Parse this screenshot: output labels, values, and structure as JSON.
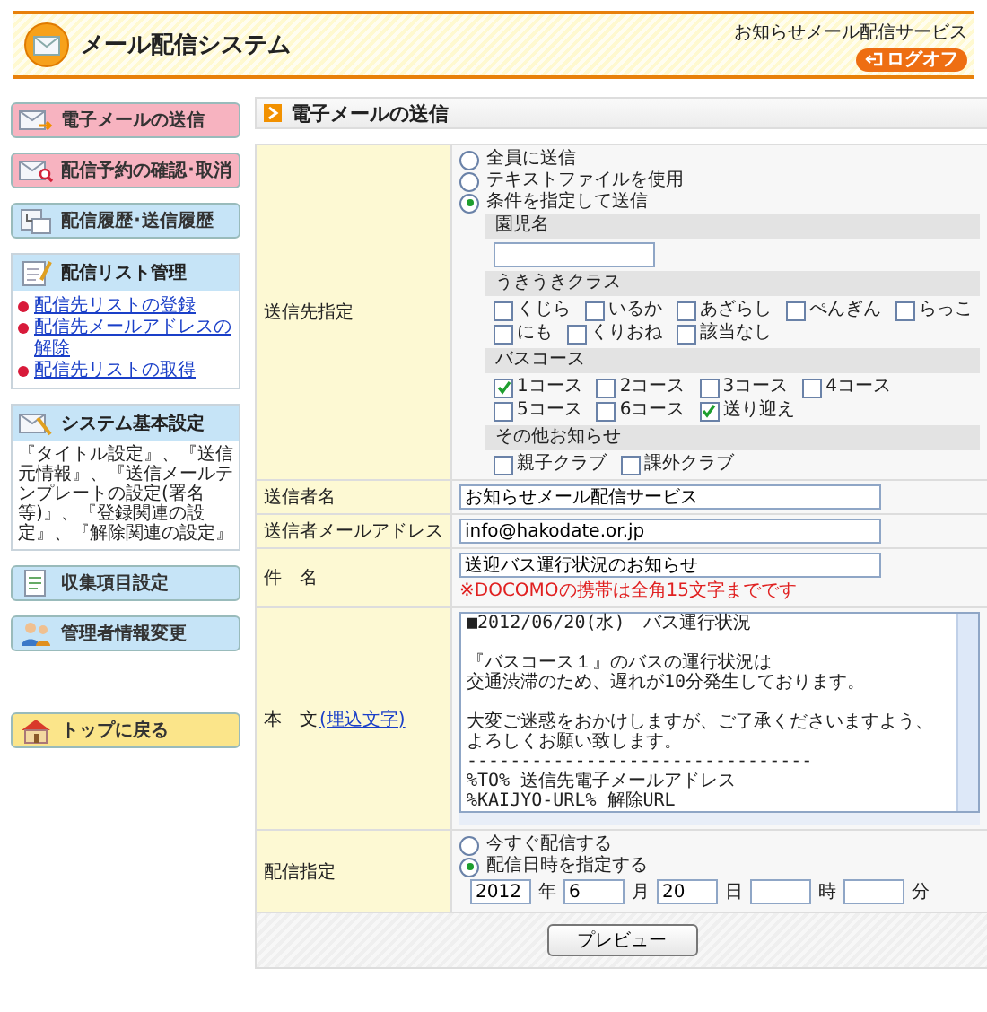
{
  "header": {
    "title": "メール配信システム",
    "service_name": "お知らせメール配信サービス",
    "logoff_button": "ログオフ"
  },
  "sidebar": {
    "items": [
      {
        "kind": "button",
        "label": "電子メールの送信",
        "color": "#f7b3c0"
      },
      {
        "kind": "button",
        "label": "配信予約の確認･取消",
        "color": "#f7b3c0"
      },
      {
        "kind": "button",
        "label": "配信履歴･送信履歴",
        "color": "#c6e4f7"
      },
      {
        "kind": "panel",
        "label": "配信リスト管理",
        "color": "#c6e4f7",
        "links": [
          "配信先リストの登録",
          "配信先メールアドレスの解除",
          "配信先リストの取得"
        ]
      },
      {
        "kind": "panel",
        "label": "システム基本設定",
        "color": "#c6e4f7",
        "description": "『タイトル設定』、『送信元情報』、『送信メールテンプレートの設定(署名等)』、『登録関連の設定』、『解除関連の設定』"
      },
      {
        "kind": "button",
        "label": "収集項目設定",
        "color": "#c6e4f7"
      },
      {
        "kind": "button",
        "label": "管理者情報変更",
        "color": "#c6e4f7"
      },
      {
        "kind": "button",
        "label": "トップに戻る",
        "color": "#fbe58a"
      }
    ]
  },
  "page_title": "電子メールの送信",
  "recipient": {
    "label": "送信先指定",
    "options": [
      {
        "label": "全員に送信",
        "selected": false
      },
      {
        "label": "テキストファイルを使用",
        "selected": false
      },
      {
        "label": "条件を指定して送信",
        "selected": true
      }
    ],
    "groups": [
      {
        "heading": "園児名",
        "kind": "text"
      },
      {
        "heading": "うきうきクラス",
        "kind": "checks",
        "items": [
          {
            "label": "くじら",
            "checked": false
          },
          {
            "label": "いるか",
            "checked": false
          },
          {
            "label": "あざらし",
            "checked": false
          },
          {
            "label": "ぺんぎん",
            "checked": false
          },
          {
            "label": "らっこ",
            "checked": false
          },
          {
            "label": "にも",
            "checked": false
          },
          {
            "label": "くりおね",
            "checked": false
          },
          {
            "label": "該当なし",
            "checked": false
          }
        ]
      },
      {
        "heading": "バスコース",
        "kind": "checks",
        "items": [
          {
            "label": "1コース",
            "checked": true
          },
          {
            "label": "2コース",
            "checked": false
          },
          {
            "label": "3コース",
            "checked": false
          },
          {
            "label": "4コース",
            "checked": false
          },
          {
            "label": "5コース",
            "checked": false
          },
          {
            "label": "6コース",
            "checked": false
          },
          {
            "label": "送り迎え",
            "checked": true
          }
        ]
      },
      {
        "heading": "その他お知らせ",
        "kind": "checks",
        "items": [
          {
            "label": "親子クラブ",
            "checked": false
          },
          {
            "label": "課外クラブ",
            "checked": false
          }
        ]
      }
    ]
  },
  "sender_name": {
    "label": "送信者名",
    "value": "お知らせメール配信サービス"
  },
  "sender_email": {
    "label": "送信者メールアドレス",
    "value": "info@hakodate.or.jp"
  },
  "subject": {
    "label": "件　名",
    "value": "送迎バス運行状況のお知らせ",
    "note": "※DOCOMOの携帯は全角15文字までです"
  },
  "body": {
    "label": "本　文",
    "link": "(埋込文字)",
    "paragraphs": [
      [
        "■2012/06/20(水)　バス運行状況"
      ],
      [
        "『バスコース１』のバスの運行状況は",
        "交通渋滞のため、遅れが10分発生しております。"
      ],
      [
        "大変ご迷惑をおかけしますが、ご了承くださいますよう、",
        "よろしくお願い致します。",
        "--------------------------------",
        "%TO% 送信先電子メールアドレス",
        "%KAIJYO-URL% 解除URL"
      ]
    ]
  },
  "schedule": {
    "label": "配信指定",
    "options": [
      {
        "label": "今すぐ配信する",
        "selected": false
      },
      {
        "label": "配信日時を指定する",
        "selected": true
      }
    ],
    "fields": [
      {
        "value": "2012",
        "unit": "年"
      },
      {
        "value": "6",
        "unit": "月"
      },
      {
        "value": "20",
        "unit": "日"
      },
      {
        "unit": "時"
      },
      {
        "unit": "分"
      }
    ]
  },
  "preview_button": "プレビュー"
}
